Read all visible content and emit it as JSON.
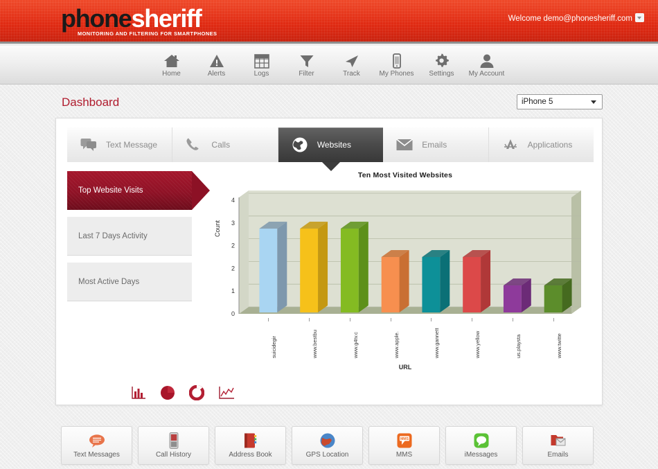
{
  "header": {
    "logo_primary": "phone",
    "logo_secondary": "sheriff",
    "tagline": "MONITORING AND FILTERING FOR SMARTPHONES",
    "welcome": "Welcome demo@phonesheriff.com",
    "brand_red": "#e02a12"
  },
  "nav": {
    "items": [
      {
        "label": "Home",
        "icon": "home-icon"
      },
      {
        "label": "Alerts",
        "icon": "alert-triangle-icon"
      },
      {
        "label": "Logs",
        "icon": "grid-table-icon"
      },
      {
        "label": "Filter",
        "icon": "funnel-icon"
      },
      {
        "label": "Track",
        "icon": "paper-plane-icon"
      },
      {
        "label": "My Phones",
        "icon": "phone-device-icon"
      },
      {
        "label": "Settings",
        "icon": "gear-icon"
      },
      {
        "label": "My Account",
        "icon": "user-icon"
      }
    ]
  },
  "page": {
    "title": "Dashboard",
    "title_color": "#b01c2e",
    "device_selected": "iPhone 5"
  },
  "tabs": [
    {
      "label": "Text Message",
      "icon": "speech-bubbles-icon",
      "active": false
    },
    {
      "label": "Calls",
      "icon": "handset-icon",
      "active": false
    },
    {
      "label": "Websites",
      "icon": "globe-icon",
      "active": true
    },
    {
      "label": "Emails",
      "icon": "envelope-icon",
      "active": false
    },
    {
      "label": "Applications",
      "icon": "appstore-icon",
      "active": false
    }
  ],
  "side_menu": [
    {
      "label": "Top Website Visits",
      "active": true
    },
    {
      "label": "Last 7 Days Activity",
      "active": false
    },
    {
      "label": "Most Active Days",
      "active": false
    }
  ],
  "chart_icons": [
    {
      "name": "bar-chart-icon"
    },
    {
      "name": "pie-chart-icon"
    },
    {
      "name": "donut-chart-icon"
    },
    {
      "name": "line-chart-icon"
    }
  ],
  "shortcuts": [
    {
      "label": "Text Messages",
      "icon": "speech-bubble-orange-icon"
    },
    {
      "label": "Call History",
      "icon": "cellphone-icon"
    },
    {
      "label": "Address Book",
      "icon": "address-book-icon"
    },
    {
      "label": "GPS Location",
      "icon": "globe-gps-icon"
    },
    {
      "label": "MMS",
      "icon": "mms-icon"
    },
    {
      "label": "iMessages",
      "icon": "imessage-green-icon"
    },
    {
      "label": "Emails",
      "icon": "email-folder-icon"
    }
  ],
  "chart_data": {
    "type": "bar",
    "title": "Ten Most Visited Websites",
    "xlabel": "URL",
    "ylabel": "Count",
    "ylim": [
      0,
      4
    ],
    "yticks": [
      "4",
      "3",
      "2",
      "2",
      "1",
      "0"
    ],
    "grid": true,
    "legend": "none",
    "categories": [
      "suicidegir",
      "www.bestbu",
      "www.g4tv.c",
      "www.apple.",
      "www.gannett",
      "www.yellow",
      "us.playsta",
      "www.twitte"
    ],
    "values": [
      3,
      3,
      3,
      2,
      2,
      2,
      1,
      1
    ],
    "colors": [
      "#a9d5f2",
      "#f6c11a",
      "#84bb22",
      "#f78f4f",
      "#0d9098",
      "#dc4949",
      "#8e3a9b",
      "#5c8d2b"
    ],
    "side_colors": [
      "#7e98ad",
      "#c49812",
      "#5d901a",
      "#c96f33",
      "#0b7076",
      "#b03838",
      "#6c2b77",
      "#456a1f"
    ]
  }
}
